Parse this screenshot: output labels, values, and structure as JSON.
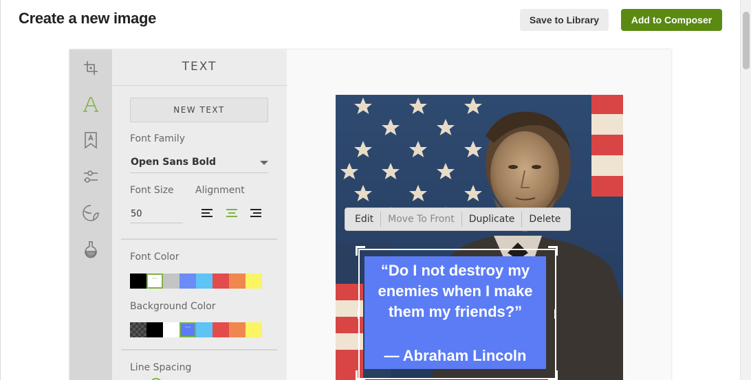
{
  "header": {
    "title": "Create a new image",
    "save_label": "Save to Library",
    "add_label": "Add to Composer"
  },
  "tools": {
    "items": [
      {
        "name": "crop-icon"
      },
      {
        "name": "text-icon",
        "active": true
      },
      {
        "name": "badge-icon"
      },
      {
        "name": "filters-icon"
      },
      {
        "name": "sticker-icon"
      },
      {
        "name": "flask-icon"
      }
    ]
  },
  "panel": {
    "title": "TEXT",
    "new_text_label": "NEW TEXT",
    "font_family_label": "Font Family",
    "font_family_value": "Open Sans Bold",
    "font_size_label": "Font Size",
    "font_size_value": "50",
    "alignment_label": "Alignment",
    "alignment_selected": "center",
    "font_color_label": "Font Color",
    "font_colors": [
      "#000000",
      "#ffffff",
      "#c4c4c4",
      "#6b8cf6",
      "#5ec3f5",
      "#e34c4c",
      "#f0874f",
      "#fbf463"
    ],
    "font_color_selected": 1,
    "background_color_label": "Background Color",
    "background_colors": [
      "transparent",
      "#000000",
      "#ffffff",
      "#5b7cf5",
      "#5ec3f5",
      "#e34c4c",
      "#f0874f",
      "#fbf463"
    ],
    "background_color_selected": 3,
    "line_spacing_label": "Line Spacing"
  },
  "canvas": {
    "context_menu": {
      "edit": "Edit",
      "move_to_front": "Move To Front",
      "duplicate": "Duplicate",
      "delete": "Delete"
    },
    "quote": "“Do I not destroy my enemies when I make them my friends?”",
    "attribution": "— Abraham Lincoln",
    "text_box_color": "#5b7cf5"
  },
  "accent_color": "#7cb342",
  "primary_button_color": "#5a8a12"
}
